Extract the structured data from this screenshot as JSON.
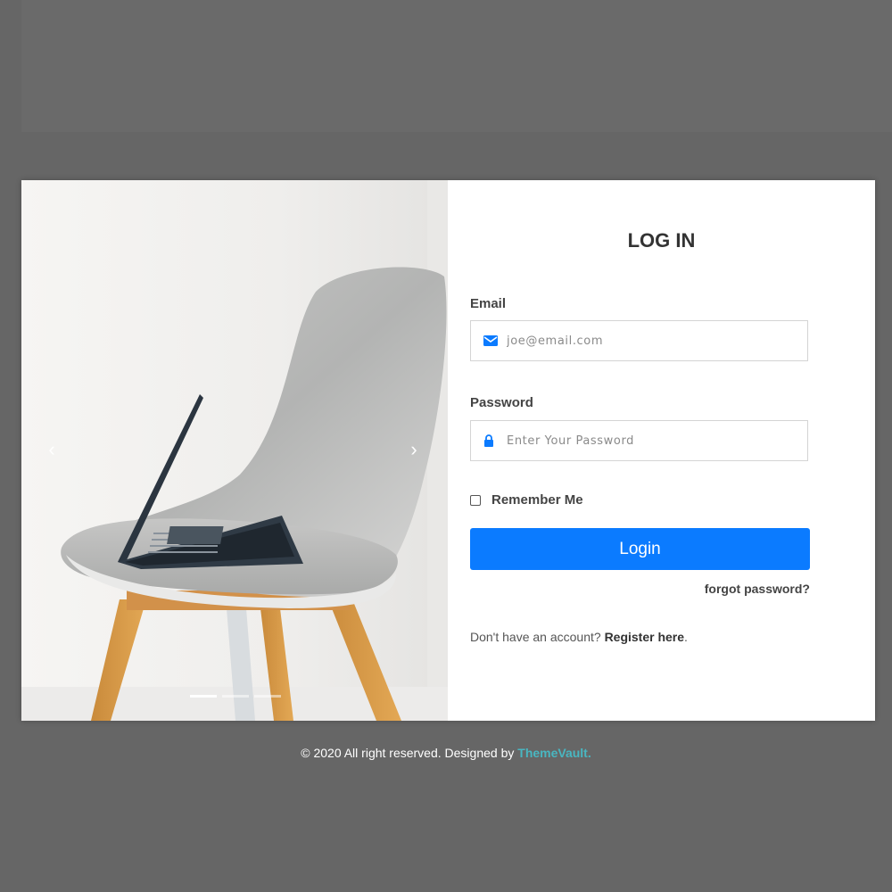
{
  "carousel": {
    "prev_glyph": "‹",
    "next_glyph": "›",
    "indicators": [
      {
        "active": true
      },
      {
        "active": false
      },
      {
        "active": false
      }
    ],
    "image_alt": "White chair with laptop"
  },
  "form": {
    "title": "LOG IN",
    "email": {
      "label": "Email",
      "placeholder": "joe@email.com",
      "value": "",
      "icon": "envelope-icon"
    },
    "password": {
      "label": "Password",
      "placeholder": "Enter Your Password",
      "value": "",
      "icon": "lock-icon"
    },
    "remember_label": "Remember Me",
    "remember_checked": false,
    "login_label": "Login",
    "forgot_label": "forgot password?",
    "register_prefix": "Don't have an account?",
    "register_link": "Register here",
    "register_suffix": "."
  },
  "footer": {
    "text": "© 2020 All right reserved. Designed by",
    "brand": "ThemeVault."
  },
  "colors": {
    "accent": "#0b7bff",
    "brand": "#49b6c1",
    "background": "#666666"
  }
}
